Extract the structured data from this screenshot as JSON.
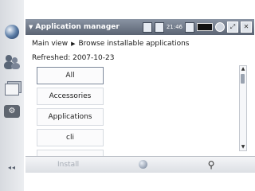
{
  "titlebar": {
    "menu_title": "Application manager",
    "clock": "21:46",
    "icons": [
      "document-icon",
      "bluetooth-document-icon",
      "battery-icon",
      "connectivity-icon",
      "close-icon"
    ]
  },
  "breadcrumb": {
    "root": "Main view",
    "current": "Browse installable applications"
  },
  "refreshed_label": "Refreshed: 2007-10-23",
  "categories": [
    {
      "label": "All",
      "selected": true
    },
    {
      "label": "Accessories",
      "selected": false
    },
    {
      "label": "Applications",
      "selected": false
    },
    {
      "label": "cli",
      "selected": false
    }
  ],
  "bottombar": {
    "install_label": "Install",
    "install_enabled": false
  }
}
